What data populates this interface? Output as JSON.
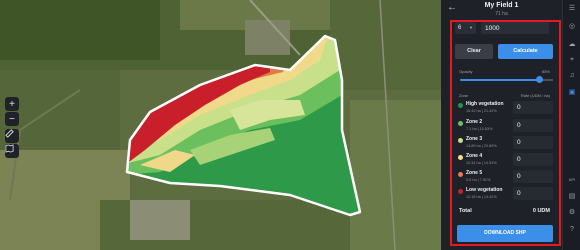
{
  "panel": {
    "back_icon": "arrow-left-icon",
    "title": "My Field 1",
    "subtitle": "71 ha",
    "zones_count": "6",
    "rate_value": "1000",
    "clear_label": "Clear",
    "calculate_label": "Calculate",
    "opacity_label": "Opacity",
    "opacity_value": "85%",
    "opacity_fraction": 0.85,
    "zone_col_label": "Zone",
    "rate_col_label": "Rate (UDM / ha)",
    "zones": [
      {
        "name": "High vegetation",
        "stat": "15.42 ha | 21.42%",
        "value": "0",
        "color": "#1f9a4a"
      },
      {
        "name": "Zone 2",
        "stat": "7.1 ha | 10.63%",
        "value": "0",
        "color": "#6cc05a"
      },
      {
        "name": "Zone 3",
        "stat": "14.89 ha | 20.89%",
        "value": "0",
        "color": "#c9e08a"
      },
      {
        "name": "Zone 4",
        "stat": "10.34 ha | 14.53%",
        "value": "0",
        "color": "#f3de8a"
      },
      {
        "name": "Zone 5",
        "stat": "5.6 ha | 7.91%",
        "value": "0",
        "color": "#e87b4a"
      },
      {
        "name": "Low vegetation",
        "stat": "10.18 ha | 14.42%",
        "value": "0",
        "color": "#c81f2a"
      }
    ],
    "total_label": "Total",
    "total_value": "0 UDM",
    "download_label": "DOWNLOAD SHP"
  },
  "map": {
    "zoom_in": "+",
    "zoom_out": "−",
    "ruler_icon": "ruler-icon",
    "layers_icon": "map-layers-icon"
  },
  "rail": {
    "menu_icon": "hamburger-icon",
    "api_label": "API",
    "icons": [
      "globe-icon",
      "cloud-icon",
      "map-pin-icon",
      "bell-icon",
      "calendar-icon",
      "sliders-icon",
      "help-icon"
    ]
  },
  "colors": {
    "accent": "#3b8fe8",
    "highlight": "#e31b23",
    "panel_bg": "#1e2228"
  }
}
